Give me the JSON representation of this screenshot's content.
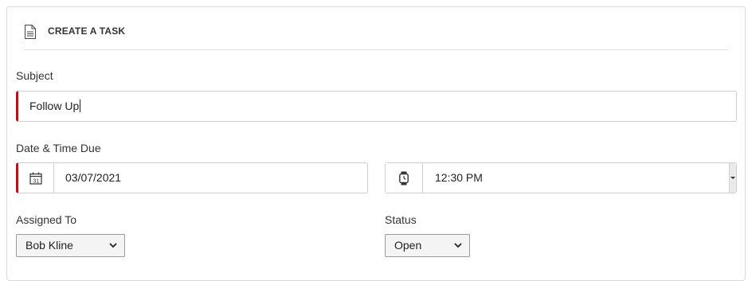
{
  "form": {
    "title": "CREATE A TASK",
    "title_icon": "document-icon",
    "accent_color": "#b3141c"
  },
  "subject": {
    "label": "Subject",
    "value": "Follow Up",
    "required": true
  },
  "due": {
    "label": "Date & Time Due",
    "date": {
      "value": "03/07/2021",
      "icon": "calendar-icon",
      "required": true
    },
    "time": {
      "value": "12:30 PM",
      "icon": "watch-icon"
    }
  },
  "assigned_to": {
    "label": "Assigned To",
    "selected": "Bob Kline"
  },
  "status": {
    "label": "Status",
    "selected": "Open"
  }
}
